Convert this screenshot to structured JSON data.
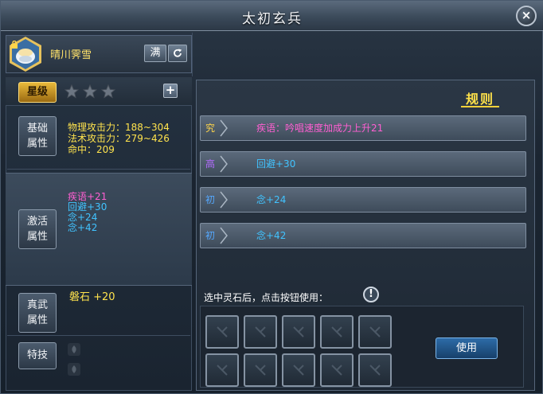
{
  "window": {
    "title": "太初玄兵",
    "close_label": "×"
  },
  "hero": {
    "name": "晴川霁雪",
    "full_label": "满",
    "refresh_icon": "refresh-icon"
  },
  "star": {
    "label": "星级",
    "stars_filled": 0,
    "stars_total": 3,
    "add_label": "+"
  },
  "basic": {
    "label_line1": "基础",
    "label_line2": "属性",
    "lines": [
      "物理攻击力：188~304",
      "法术攻击力：279~426",
      "命中：209"
    ]
  },
  "active": {
    "label_line1": "激活",
    "label_line2": "属性",
    "lines": [
      {
        "text": "疾语+21",
        "color": "#ff5fd2"
      },
      {
        "text": "回避+30",
        "color": "#41c3ff"
      },
      {
        "text": "念+24",
        "color": "#41c3ff"
      },
      {
        "text": "念+42",
        "color": "#41c3ff"
      }
    ]
  },
  "zhenwu": {
    "label_line1": "真武",
    "label_line2": "属性",
    "value": "磐石 +20"
  },
  "skill": {
    "label": "特技"
  },
  "rules": {
    "label": "规则"
  },
  "slots": [
    {
      "tier": "究",
      "tier_color": "#ffd54a",
      "text": "疾语：吟唱速度加成力上升21",
      "text_color": "#ff5fd2"
    },
    {
      "tier": "高",
      "tier_color": "#b36bff",
      "text": "回避+30",
      "text_color": "#41c3ff"
    },
    {
      "tier": "初",
      "tier_color": "#54a8ff",
      "text": "念+24",
      "text_color": "#41c3ff"
    },
    {
      "tier": "初",
      "tier_color": "#54a8ff",
      "text": "念+42",
      "text_color": "#41c3ff"
    }
  ],
  "stone": {
    "hint": "选中灵石后，点击按钮使用：",
    "info_label": "!",
    "use_label": "使用"
  }
}
